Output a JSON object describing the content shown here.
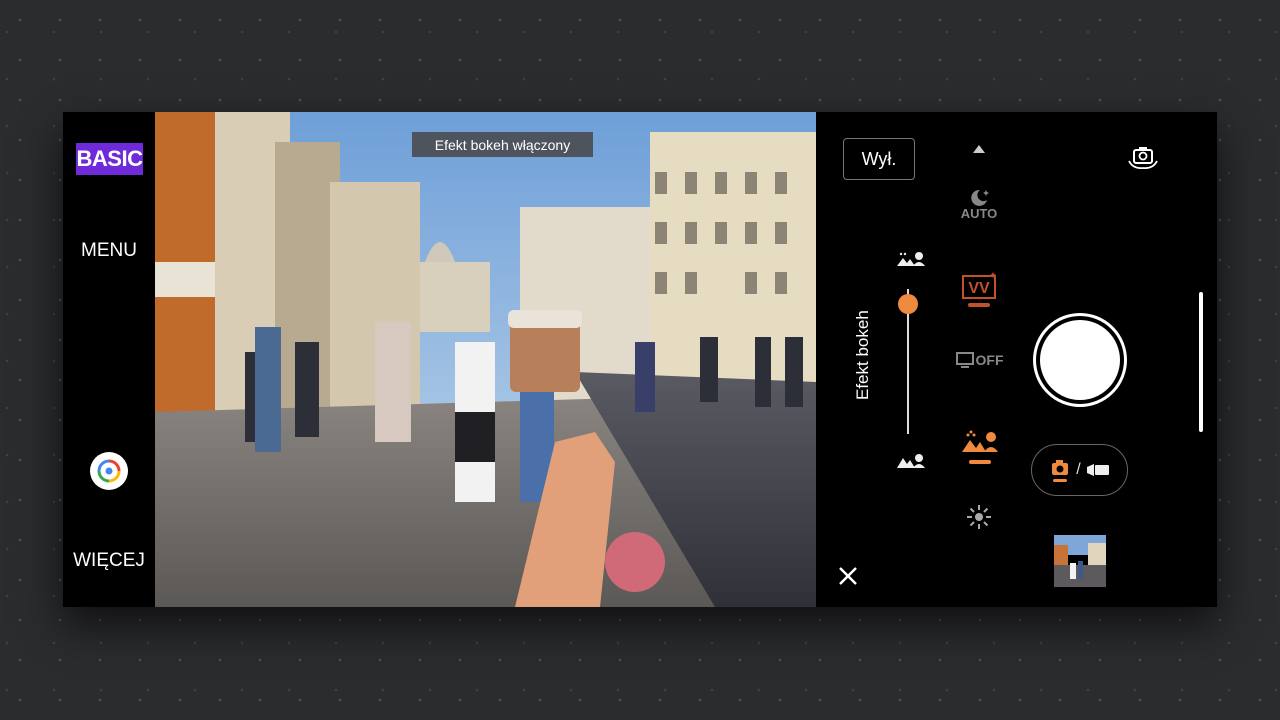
{
  "left_bar": {
    "mode_badge": "BASIC",
    "menu_label": "MENU",
    "lens_icon": "google-lens-icon",
    "more_label": "WIĘCEJ"
  },
  "viewfinder": {
    "toast": "Efekt bokeh włączony"
  },
  "right_panel": {
    "off_button": "Wył.",
    "slider_label": "Efekt bokeh",
    "bokeh_level": 0.9,
    "mode_icons": [
      "scroll-up-icon",
      "night-auto-icon",
      "video-stabilizer-icon",
      "screen-off-icon",
      "bokeh-icon",
      "brightness-icon"
    ],
    "night_auto_label": "AUTO",
    "screen_off_label": "OFF",
    "mode_separator": "/",
    "camera_switch_icon": "camera-switch-icon",
    "shutter_icon": "shutter-button",
    "photo_video_icons": [
      "photo-icon",
      "video-icon"
    ],
    "close_icon": "close-icon",
    "accent_color": "#f08a3e",
    "badge_color": "#6f2bd9"
  }
}
